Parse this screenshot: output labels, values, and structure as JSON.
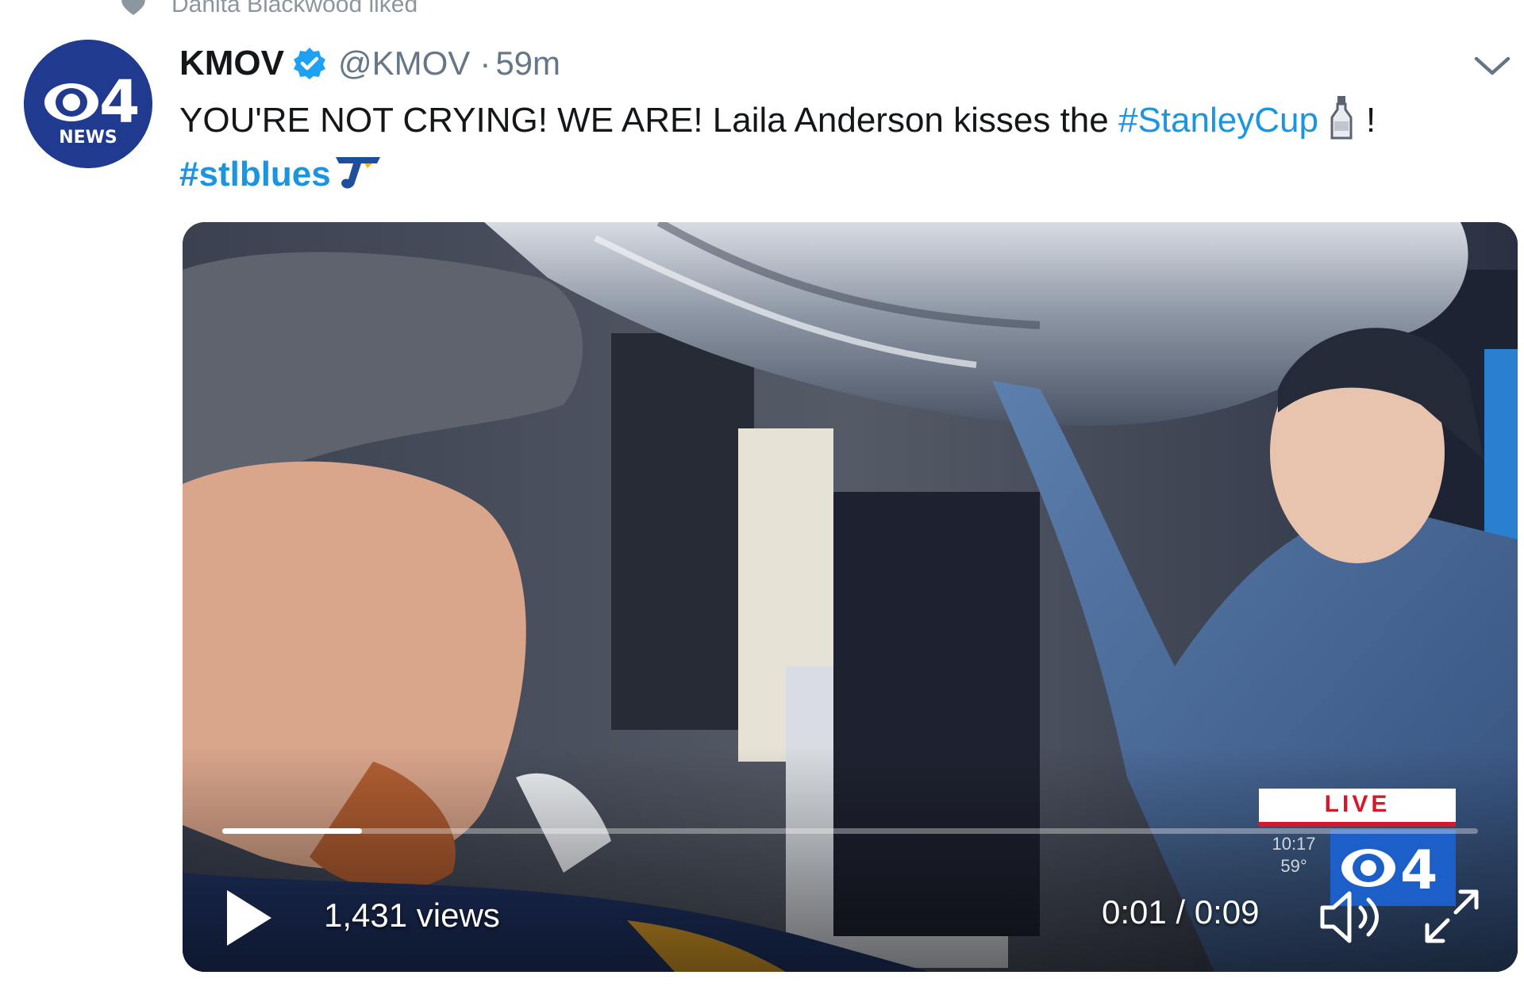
{
  "activity": {
    "text": "Danita Blackwood liked"
  },
  "tweet": {
    "author_name": "KMOV",
    "handle": "@KMOV",
    "separator": "·",
    "time": "59m",
    "text_part1": "YOU'RE NOT CRYING! WE ARE! Laila Anderson kisses the ",
    "hashtag1": "#StanleyCup",
    "text_part2": "!",
    "hashtag2": "#stlblues",
    "avatar": {
      "channel": "4",
      "label": "NEWS"
    }
  },
  "video": {
    "views": "1,431 views",
    "time_readout": "0:01 / 0:09",
    "progress": 0.111,
    "overlay": {
      "live": "LIVE",
      "time": "10:17",
      "temp": "59°",
      "channel": "4"
    }
  },
  "colors": {
    "link": "#1b95e0",
    "verified": "#1da1f2",
    "live_red": "#d7182a",
    "cbs_blue": "#1f3a8f"
  },
  "icons": {
    "caret": "chevron-down-icon",
    "verified": "verified-badge-icon",
    "play": "play-icon",
    "volume": "volume-icon",
    "fullscreen": "fullscreen-icon",
    "liked": "heart-icon"
  }
}
